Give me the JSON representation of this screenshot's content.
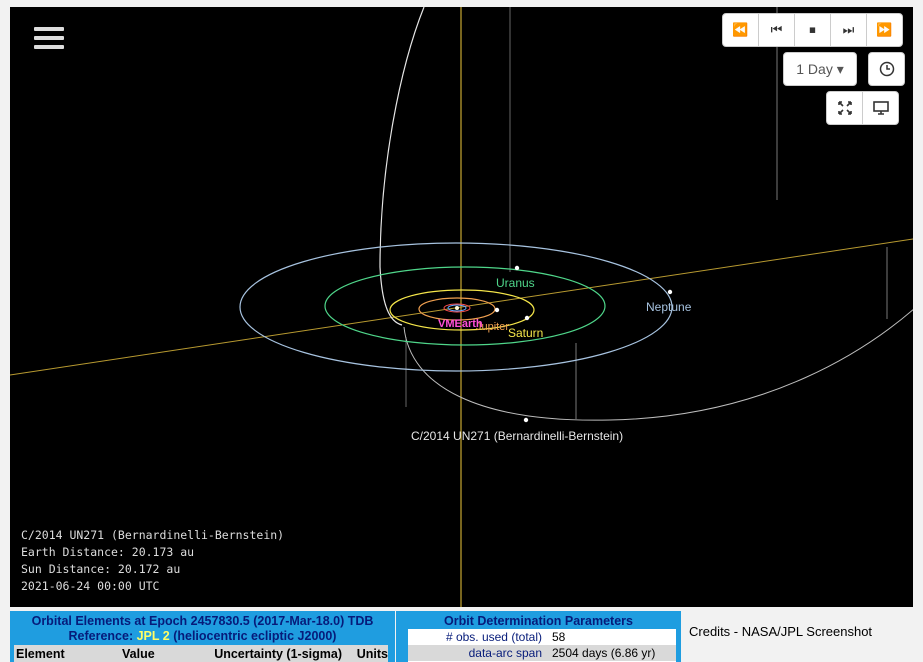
{
  "toolbar": {
    "menu_icon": "hamburger-menu-icon",
    "playback": [
      {
        "name": "fast-rewind-button",
        "icon": "fast-rewind-icon",
        "glyph": "⏪"
      },
      {
        "name": "step-back-button",
        "icon": "step-back-icon",
        "glyph": "⏮"
      },
      {
        "name": "stop-button",
        "icon": "stop-icon",
        "glyph": "⏹"
      },
      {
        "name": "step-forward-button",
        "icon": "step-forward-icon",
        "glyph": "⏭"
      },
      {
        "name": "fast-forward-button",
        "icon": "fast-forward-icon",
        "glyph": "⏩"
      }
    ],
    "speed_label": "1 Day ▾",
    "clock_icon": "clock-icon",
    "fullscreen_icon": "fullscreen-icon",
    "screen_icon": "monitor-icon"
  },
  "labels": {
    "uranus": "Uranus",
    "neptune": "Neptune",
    "saturn": "Saturn",
    "jupiter": "Jupiter",
    "inner_cluster": "VMEarth",
    "comet": "C/2014 UN271 (Bernardinelli-Bernstein)"
  },
  "colors": {
    "neptune": "#a7c3e0",
    "uranus": "#4fd68a",
    "saturn": "#f5e64a",
    "jupiter": "#f0a050",
    "comet_orbit": "#d8d8d8",
    "ecliptic_axis": "#b89a30"
  },
  "info": {
    "object": "C/2014 UN271 (Bernardinelli-Bernstein)",
    "earth_distance": "Earth Distance: 20.173 au",
    "sun_distance": "Sun Distance: 20.172 au",
    "datetime": "2021-06-24 00:00 UTC"
  },
  "elements_panel": {
    "title": "Orbital Elements at Epoch 2457830.5 (2017-Mar-18.0) TDB",
    "reference_prefix": "Reference: ",
    "reference_link": "JPL 2",
    "reference_suffix": " (heliocentric ecliptic J2000)",
    "columns": [
      "Element",
      "Value",
      "Uncertainty (1-sigma)",
      "Units"
    ]
  },
  "od_panel": {
    "title": "Orbit Determination Parameters",
    "rows": [
      {
        "key": "# obs. used (total)",
        "value": "58"
      },
      {
        "key": "data-arc span",
        "value": "2504 days (6.86 yr)"
      }
    ]
  },
  "credits": "Credits - NASA/JPL Screenshot"
}
